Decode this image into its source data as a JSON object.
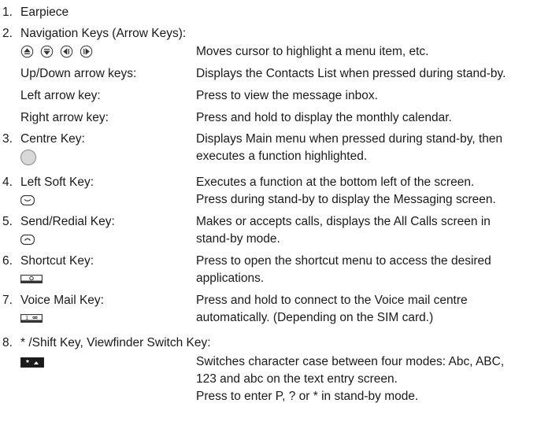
{
  "items": [
    {
      "num": "1.",
      "label": "Earpiece"
    },
    {
      "num": "2.",
      "label": "Navigation Keys (Arrow Keys):",
      "subs": [
        {
          "label": "",
          "desc": "Moves cursor to highlight a menu item, etc."
        },
        {
          "label": "Up/Down arrow keys:",
          "desc": "Displays the Contacts List when pressed during stand-by."
        },
        {
          "label": "Left arrow key:",
          "desc": "Press to view the message inbox."
        },
        {
          "label": "Right arrow key:",
          "desc": "Press and hold to display the monthly calendar."
        }
      ]
    },
    {
      "num": "3.",
      "label": "Centre Key:",
      "desc1": "Displays Main menu when pressed during stand-by, then",
      "desc2": "executes a function highlighted."
    },
    {
      "num": "4.",
      "label": "Left Soft Key:",
      "desc1": "Executes a function at the bottom left of the screen.",
      "desc2": "Press during stand-by to display the Messaging screen."
    },
    {
      "num": "5.",
      "label": "Send/Redial Key:",
      "desc1": "Makes or accepts calls, displays the All Calls screen in",
      "desc2": "stand-by mode."
    },
    {
      "num": "6.",
      "label": "Shortcut Key:",
      "desc1": "Press to open the shortcut menu to access the desired",
      "desc2": "applications."
    },
    {
      "num": "7.",
      "label": "Voice Mail Key:",
      "desc1": "Press and hold to connect to the Voice mail centre",
      "desc2": "automatically. (Depending on the SIM card.)"
    },
    {
      "num": "8.",
      "label": "* /Shift Key, Viewfinder Switch Key:",
      "desc1": "Switches character case between four modes: Abc, ABC,",
      "desc2": "123 and abc on the text entry screen.",
      "desc3": "Press to enter P, ? or * in stand-by mode."
    }
  ],
  "key_glyphs": {
    "voicemail": "1",
    "star": "*"
  },
  "icons": [
    "up-arrow-icon",
    "down-arrow-icon",
    "left-arrow-icon",
    "right-arrow-icon",
    "centre-key-icon",
    "left-soft-key-icon",
    "send-key-icon",
    "shortcut-key-icon",
    "voicemail-key-icon",
    "star-key-icon"
  ]
}
